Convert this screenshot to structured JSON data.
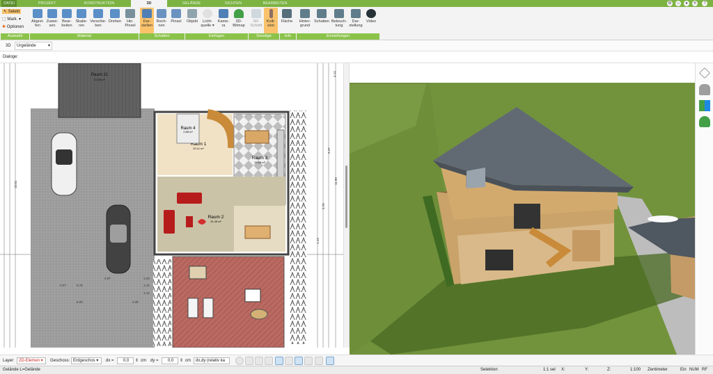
{
  "menu": {
    "tabs": [
      "DATEI",
      "PROJEKT",
      "KONSTRUKTION",
      "3D",
      "GELÄNDE",
      "SICHTEN",
      "BEARBEITEN"
    ],
    "active": "3D"
  },
  "ribbon": {
    "left": {
      "selekt": "Selekt",
      "mark": "Mark.",
      "optionen": "Optionen"
    },
    "buttons": [
      {
        "l1": "Abgrei-",
        "l2": "fen"
      },
      {
        "l1": "Zuwei-",
        "l2": "sen"
      },
      {
        "l1": "Bear-",
        "l2": "beiten"
      },
      {
        "l1": "Skalie-",
        "l2": "ren"
      },
      {
        "l1": "Verschie-",
        "l2": "ben"
      },
      {
        "l1": "Drehen",
        "l2": ""
      },
      {
        "l1": "Hin.",
        "l2": "Pinsel"
      },
      {
        "l1": "Dar-",
        "l2": "stellen"
      },
      {
        "l1": "Rech-",
        "l2": "nen"
      },
      {
        "l1": "Pinsel",
        "l2": ""
      },
      {
        "l1": "Objekt",
        "l2": ""
      },
      {
        "l1": "Licht-",
        "l2": "quelle"
      },
      {
        "l1": "Kame-",
        "l2": "ra"
      },
      {
        "l1": "3D-",
        "l2": "Bitmap"
      },
      {
        "l1": "3D-",
        "l2": "Schnitt"
      },
      {
        "l1": "Kolli-",
        "l2": "sion"
      },
      {
        "l1": "Fläche",
        "l2": ""
      },
      {
        "l1": "Hinter-",
        "l2": "grund"
      },
      {
        "l1": "Schatten",
        "l2": ""
      },
      {
        "l1": "Beleuch-",
        "l2": "tung"
      },
      {
        "l1": "Dar-",
        "l2": "stellung"
      },
      {
        "l1": "Video",
        "l2": ""
      }
    ],
    "groups": [
      "Auswahl",
      "Material",
      "Schatten",
      "Einfügen",
      "Sonstige",
      "Info",
      "Einstellungen"
    ]
  },
  "bar2": {
    "mode": "3D",
    "selection": "Urgelände"
  },
  "bar3": {
    "label": "Dialoge:"
  },
  "plan": {
    "rooms": [
      {
        "name": "Raum 21",
        "area": "22.80 m²"
      },
      {
        "name": "Raum 4",
        "area": "2.88 m²"
      },
      {
        "name": "Raum 1",
        "area": "20.11 m²"
      },
      {
        "name": "Raum 3",
        "area": "15.35 m²"
      },
      {
        "name": "Raum 2",
        "area": "31.45 m²"
      }
    ],
    "dims": [
      "2.07",
      "6.00",
      "5.76",
      "1.13",
      "1.23",
      "2.57",
      "1.13",
      "4.30",
      "10.01",
      "5.76",
      "9.37",
      "11.90",
      "1.13",
      "4.14"
    ]
  },
  "bottom": {
    "layer_label": "Layer:",
    "layer_value": "2D-Elemen",
    "geschoss_label": "Geschoss:",
    "geschoss_value": "Erdgeschos",
    "dx_label": "dx =",
    "dx_value": "0,0",
    "dx_unit": "cm",
    "dy_label": "dy =",
    "dy_value": "0,0",
    "dy_unit": "cm",
    "mode_value": "dx,dy (relativ ka"
  },
  "status": {
    "left": "Gelände L=Gelände",
    "selektion": "Selektion",
    "sel": "1:1 sel",
    "x": "X:",
    "y": "Y:",
    "z": "Z:",
    "scale": "1:100",
    "unit": "Zentimeter",
    "ein": "Ein",
    "num": "NUM",
    "rf": "RF"
  },
  "colors": {
    "brand_green": "#7cb342",
    "group_green": "#8bc34a",
    "active_orange": "#f9c26b"
  }
}
